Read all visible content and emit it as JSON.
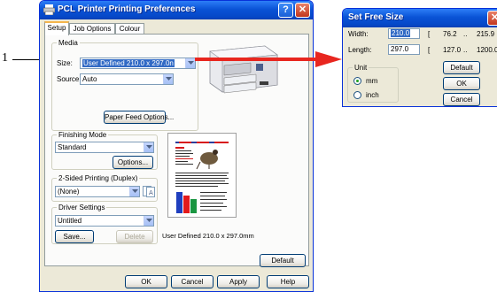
{
  "callout": {
    "number": "1"
  },
  "window": {
    "title": "PCL Printer Printing Preferences",
    "tabs": [
      "Setup",
      "Job Options",
      "Colour"
    ],
    "media": {
      "legend": "Media",
      "size_label": "Size:",
      "size_value": "User Defined 210.0 x 297.0n",
      "source_label": "Source:",
      "source_value": "Auto",
      "paper_feed_button": "Paper Feed Options..."
    },
    "finishing": {
      "legend": "Finishing Mode",
      "value": "Standard",
      "options_button": "Options..."
    },
    "duplex": {
      "legend": "2-Sided Printing (Duplex)",
      "value": "(None)"
    },
    "driver": {
      "legend": "Driver Settings",
      "value": "Untitled",
      "save_button": "Save...",
      "delete_button": "Delete"
    },
    "preview_caption": "User Defined 210.0 x 297.0mm",
    "default_button": "Default",
    "buttons": {
      "ok": "OK",
      "cancel": "Cancel",
      "apply": "Apply",
      "help": "Help"
    }
  },
  "free_size": {
    "title": "Set Free Size",
    "width_label": "Width:",
    "width_value": "210.0",
    "width_bracket": "[",
    "width_min": "76.2",
    "width_sep": "..",
    "width_max": "215.9",
    "length_label": "Length:",
    "length_value": "297.0",
    "length_bracket": "[",
    "length_min": "127.0",
    "length_sep": "..",
    "length_max": "1200.0",
    "unit_legend": "Unit",
    "unit_mm": "mm",
    "unit_inch": "inch",
    "default_button": "Default",
    "ok_button": "OK",
    "cancel_button": "Cancel"
  },
  "colors": {
    "title_blue": "#0a53d6",
    "face": "#ece9d8",
    "arrow_red": "#e8261f",
    "selection": "#316ac5"
  }
}
